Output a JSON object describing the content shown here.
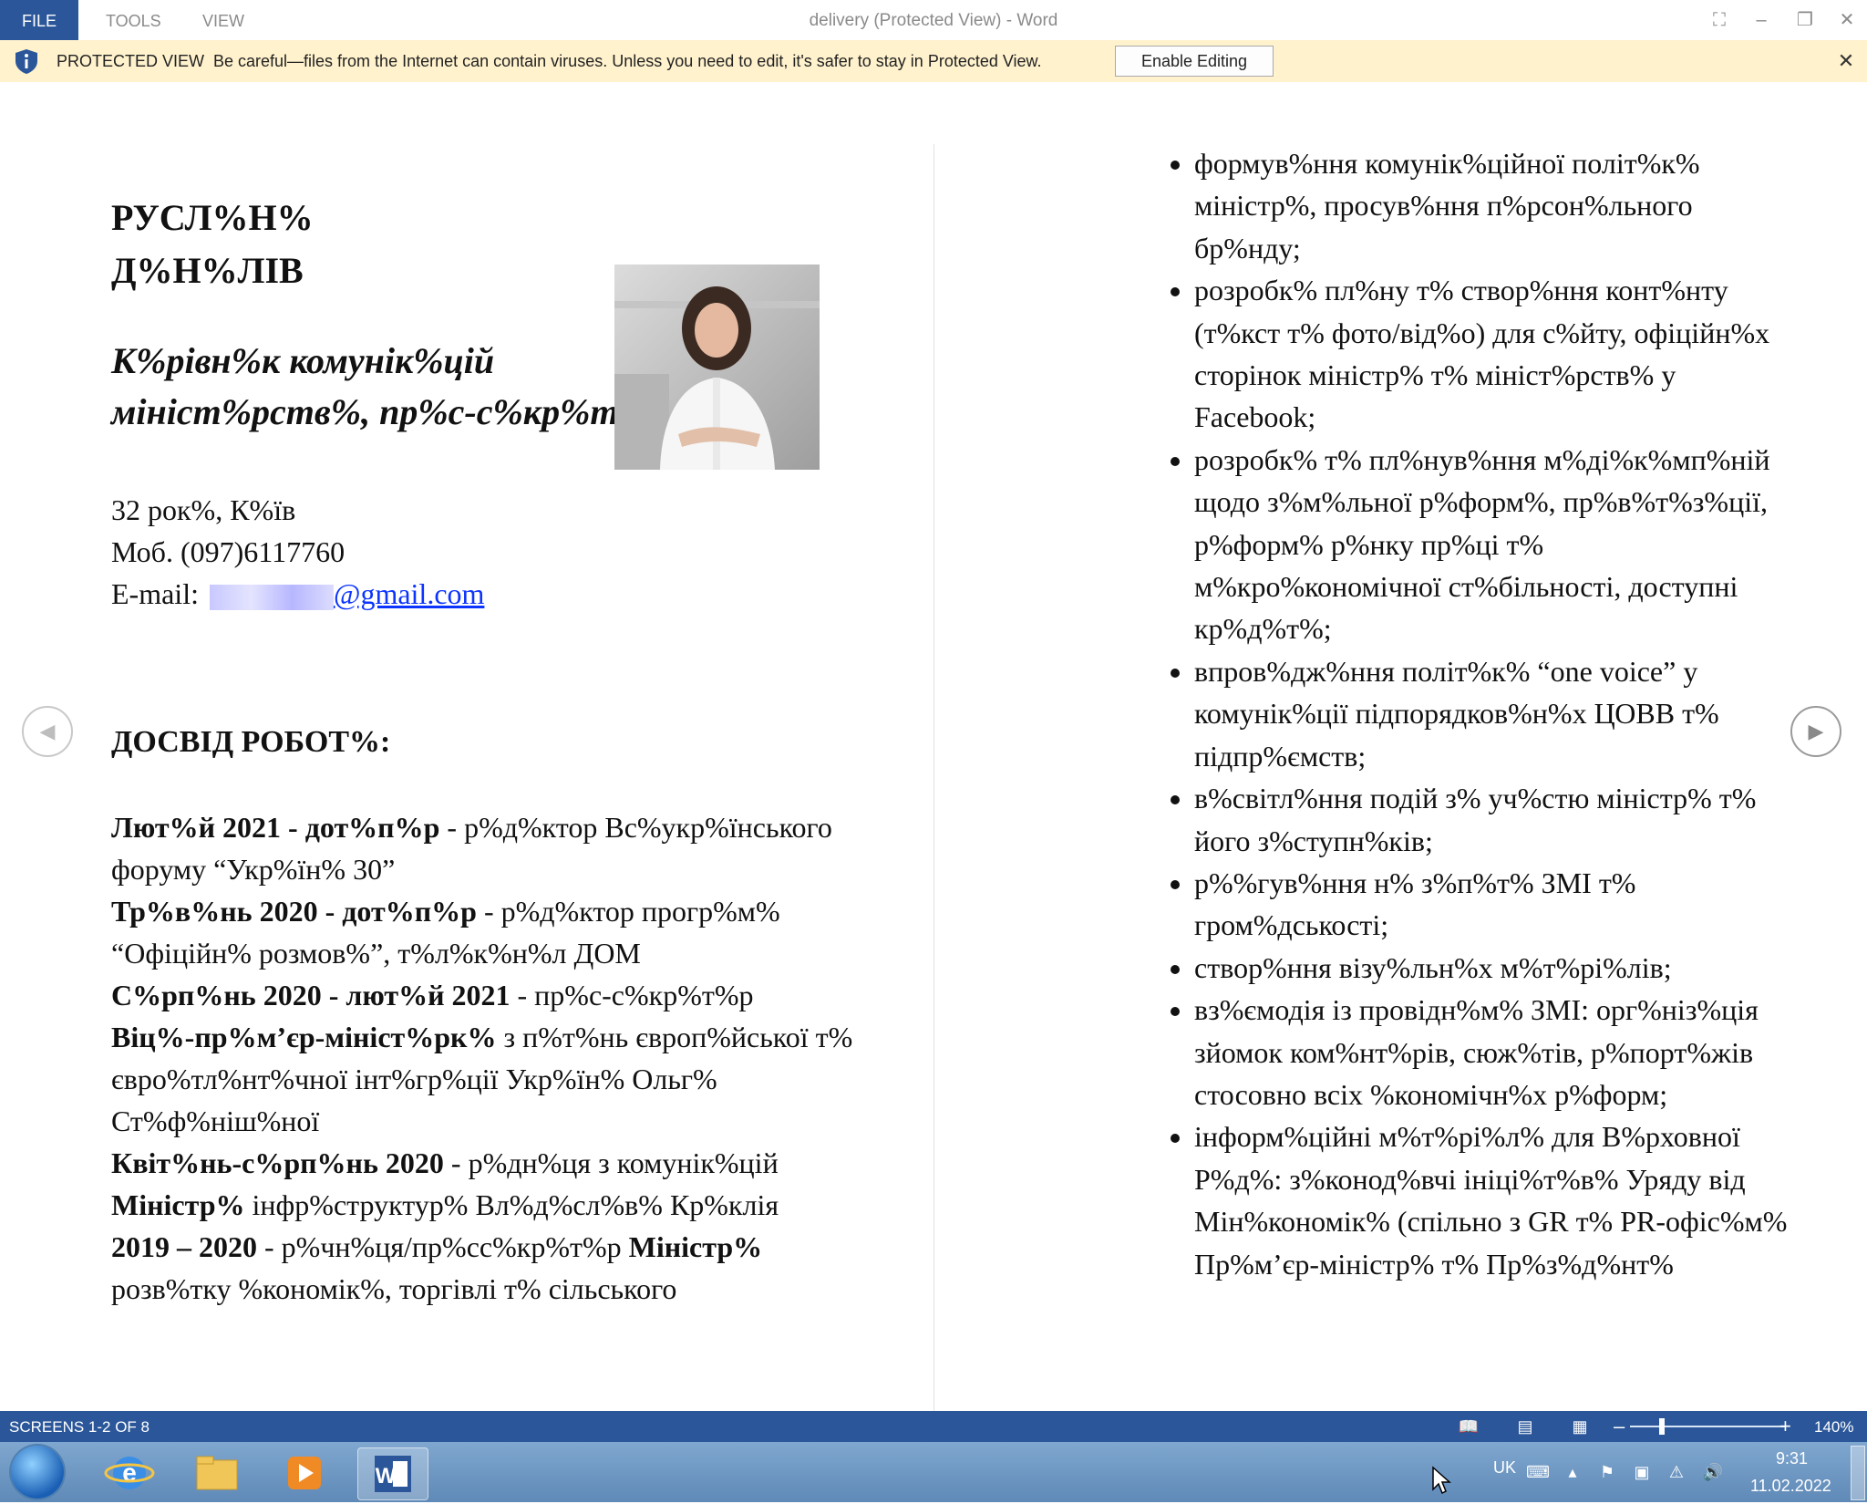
{
  "window": {
    "title": "delivery (Protected View) - Word",
    "tabs": [
      "FILE",
      "TOOLS",
      "VIEW"
    ]
  },
  "protected_view": {
    "label": "PROTECTED VIEW",
    "message": "Be careful—files from the Internet can contain viruses. Unless you need to edit, it's safer to stay in Protected View.",
    "enable_button": "Enable Editing"
  },
  "document": {
    "name_line1": "РУСЛ%Н%",
    "name_line2": "Д%Н%ЛІВ",
    "role": "К%рівн%к комунік%цій мініст%рств%, пр%с-с%кр%т%р",
    "age_city": "32 рок%,  К%їв",
    "phone": "Моб. (097)6117760",
    "email_label": "E-mail: ",
    "email_domain": "@gmail.com",
    "section_title": "ДОСВІД РОБОТ%:",
    "experience": [
      {
        "bold": "Лют%й 2021 - дот%п%р",
        "text": " - р%д%ктор Вс%укр%їнського форуму “Укр%їн% 30”"
      },
      {
        "bold": "Тр%в%нь 2020 - дот%п%р",
        "text": " - р%д%ктор прогр%м% “Офіційн% розмов%”, т%л%к%н%л ДОМ"
      },
      {
        "bold": "С%рп%нь 2020 - лют%й 2021",
        "text": " - пр%с-с%кр%т%р"
      },
      {
        "bold": "Віц%-пр%м’єр-мініст%рк%",
        "text": " з п%т%нь європ%йської т% євро%тл%нт%чної інт%гр%ції Укр%їн% Ольг% Ст%ф%ніш%ної"
      },
      {
        "bold": "Квіт%нь-с%рп%нь 2020",
        "text": "  - р%дн%ця  з комунік%цій"
      },
      {
        "bold": "Міністр%",
        "text": " інфр%структур% Вл%д%сл%в% Кр%клія"
      },
      {
        "bold": "2019 – 2020",
        "text": " -  р%чн%ця/пр%сс%кр%т%р "
      },
      {
        "bold": "Міністр%",
        "text": ""
      },
      {
        "bold": "",
        "text": "розв%тку %кономік%, торгівлі т% сільського"
      }
    ],
    "bullets": [
      "формув%ння комунік%ційної політ%к% міністр%, просув%ння п%рсон%льного бр%нду;",
      "розробк% пл%ну т% створ%ння конт%нту (т%кст т% фото/від%о) для с%йту, офіційн%х сторінок міністр% т% мініст%рств% у Facebook;",
      "розробк% т% пл%нув%ння м%ді%к%мп%ній щодо з%м%льної р%форм%, пр%в%т%з%ції, р%форм% р%нку пр%ці т% м%кро%кономічної ст%більності, доступні кр%д%т%;",
      "впров%дж%ння політ%к% “one voice” у комунік%ції підпорядков%н%х ЦОВВ т% підпр%ємств;",
      "в%світл%ння подій з% уч%стю міністр% т% його з%ступн%ків;",
      "р%%гув%ння н% з%п%т% ЗМІ т% гром%дськості;",
      "створ%ння візу%льн%х м%т%рі%лів;",
      "вз%ємодія із провідн%м% ЗМІ: орг%ніз%ція зйомок ком%нт%рів, сюж%тів, р%порт%жів стосовно всіх %кономічн%х р%форм;",
      "інформ%ційні м%т%рі%л% для В%рховної Р%д%: з%конод%вчі ініці%т%в% Уряду від Мін%кономік% (спільно з GR т% PR-офіс%м% Пр%м’єр-міністр% т% Пр%з%д%нт%"
    ]
  },
  "status_bar": {
    "screens": "SCREENS 1-2 OF 8",
    "zoom": "140%",
    "zoom_level_percent": 140
  },
  "taskbar": {
    "language": "UK",
    "time": "9:31",
    "date": "11.02.2022"
  },
  "colors": {
    "accent": "#2b579a",
    "protected_bar": "#fff2cd",
    "link": "#0b34ff"
  }
}
